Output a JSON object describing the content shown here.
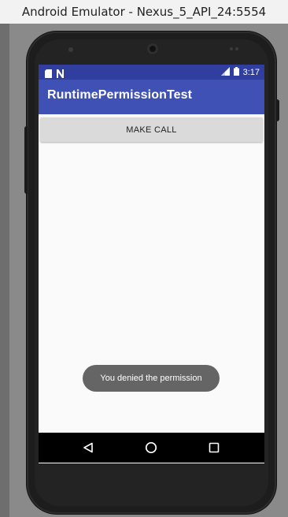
{
  "window": {
    "title": "Android Emulator - Nexus_5_API_24:5554"
  },
  "statusbar": {
    "time": "3:17",
    "left_icons": [
      "sd-card-icon",
      "n-notification-icon"
    ],
    "right_icons": [
      "signal-icon",
      "battery-icon"
    ]
  },
  "app": {
    "title": "RuntimePermissionTest"
  },
  "main": {
    "make_call_label": "MAKE CALL"
  },
  "toast": {
    "message": "You denied the permission"
  },
  "navbar": {
    "buttons": [
      "back-icon",
      "home-icon",
      "recents-icon"
    ]
  },
  "colors": {
    "statusbar": "#303f9f",
    "appbar": "#3f51b5",
    "screen_bg": "#fafafa",
    "button_bg": "#dadada",
    "toast_bg": "#656565"
  }
}
